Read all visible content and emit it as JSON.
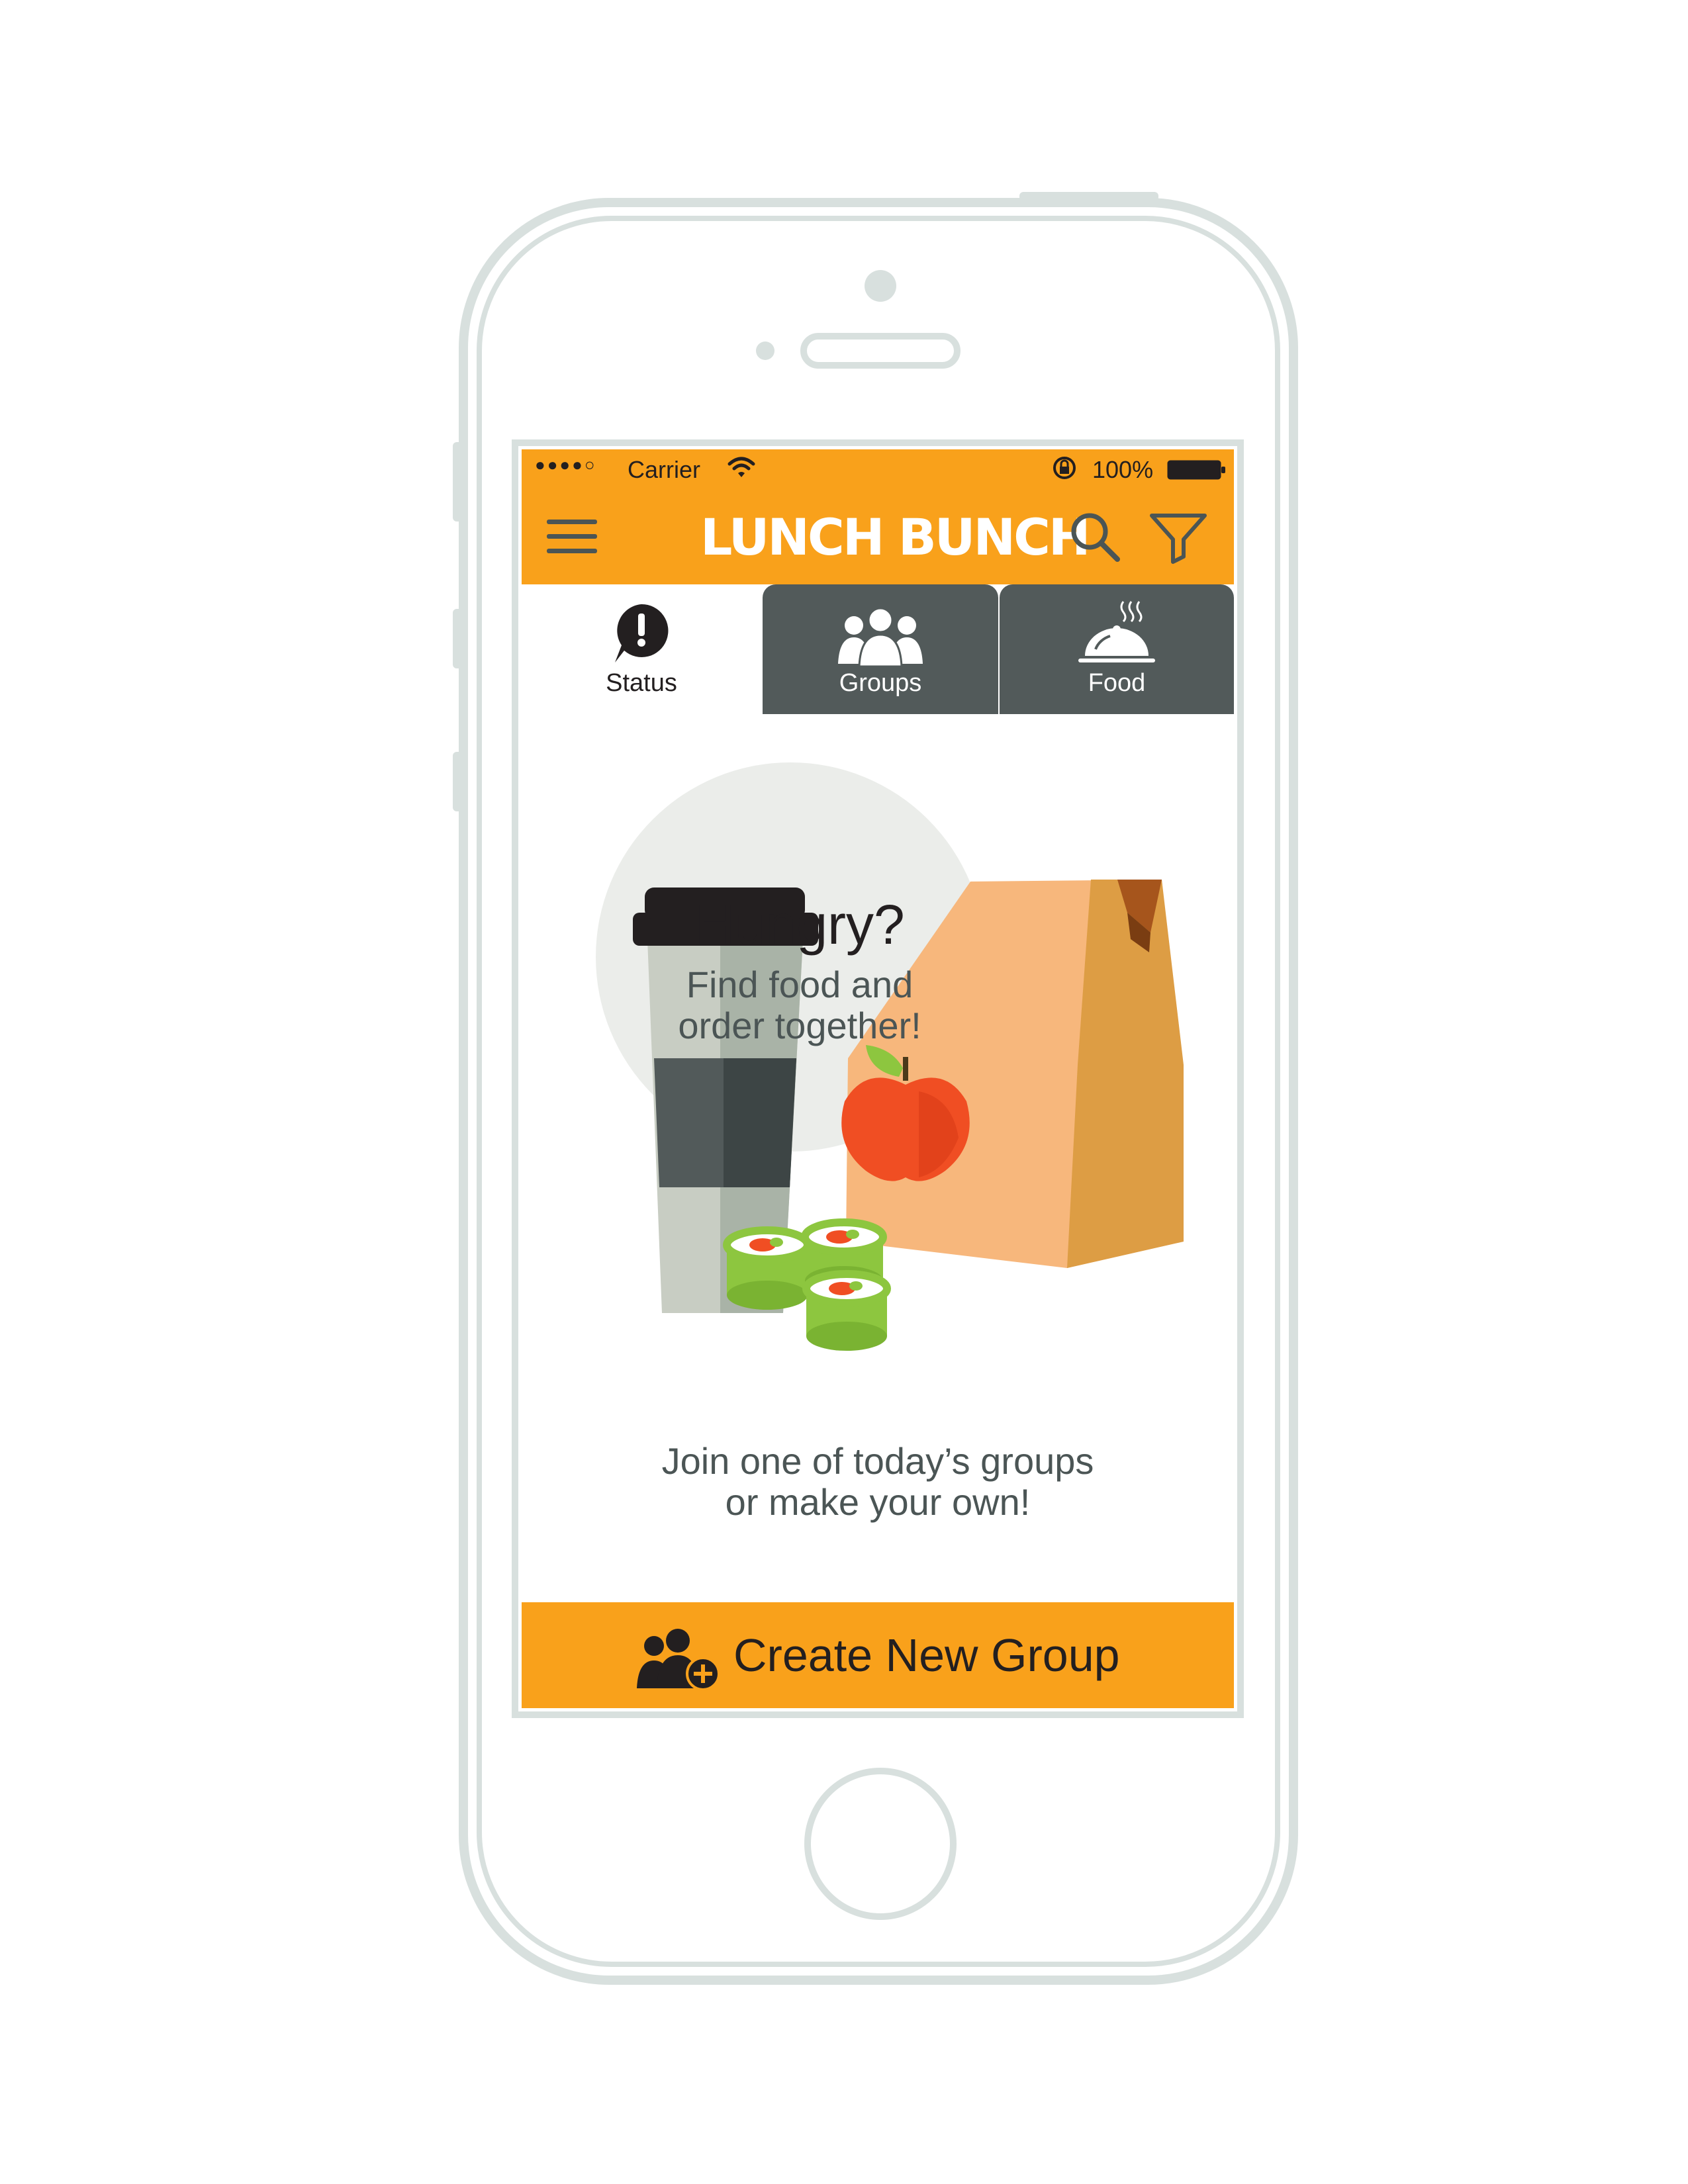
{
  "status_bar": {
    "signal": "●●●●○",
    "carrier": "Carrier",
    "battery_percent": "100%"
  },
  "nav": {
    "app_title": "LUNCH BUNCH",
    "menu_icon": "hamburger-icon",
    "search_icon": "search-icon",
    "filter_icon": "filter-icon"
  },
  "tabs": [
    {
      "label": "Status",
      "icon": "exclamation-bubble-icon",
      "active": true
    },
    {
      "label": "Groups",
      "icon": "people-icon",
      "active": false
    },
    {
      "label": "Food",
      "icon": "serving-cloche-icon",
      "active": false
    }
  ],
  "hero": {
    "title": "Hungry?",
    "subtitle_line1": "Find food and",
    "subtitle_line2": "order together!"
  },
  "prompt": {
    "line1": "Join one of today’s groups",
    "line2": "or make your own!"
  },
  "create_button": {
    "label": "Create New Group",
    "icon": "add-group-icon"
  },
  "colors": {
    "accent": "#f9a11b",
    "tab_inactive": "#525a5a",
    "text_dark": "#231f20",
    "text_muted": "#4b5555",
    "phone_outline": "#d8e0de",
    "bubble": "#ebedea",
    "bag": "#f7b77c",
    "apple": "#f04e23",
    "sushi": "#8dc63f"
  }
}
